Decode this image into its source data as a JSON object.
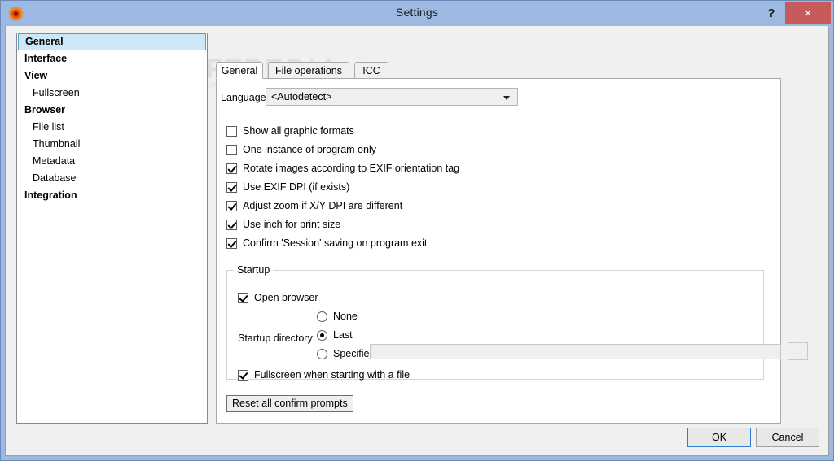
{
  "window": {
    "title": "Settings",
    "app_icon": "app-logo-icon",
    "help_label": "?",
    "close_label": "×",
    "accent_titlebar": "#9db9e2",
    "close_color": "#c75b5b",
    "selection_color": "#cce8f7"
  },
  "watermark": {
    "main": "SOFTPEDIA",
    "tm": "™",
    "sub": "www.softpedia.com"
  },
  "sidebar": {
    "items": [
      {
        "label": "General",
        "level": "top",
        "selected": true
      },
      {
        "label": "Interface",
        "level": "top",
        "selected": false
      },
      {
        "label": "View",
        "level": "top",
        "selected": false
      },
      {
        "label": "Fullscreen",
        "level": "sub",
        "selected": false
      },
      {
        "label": "Browser",
        "level": "top",
        "selected": false
      },
      {
        "label": "File list",
        "level": "sub",
        "selected": false
      },
      {
        "label": "Thumbnail",
        "level": "sub",
        "selected": false
      },
      {
        "label": "Metadata",
        "level": "sub",
        "selected": false
      },
      {
        "label": "Database",
        "level": "sub",
        "selected": false
      },
      {
        "label": "Integration",
        "level": "top",
        "selected": false
      }
    ]
  },
  "tabs": [
    {
      "label": "General",
      "active": true
    },
    {
      "label": "File operations",
      "active": false
    },
    {
      "label": "ICC",
      "active": false
    }
  ],
  "general_tab": {
    "language_label": "Language",
    "language_value": "<Autodetect>",
    "language_arrow_icon": "chevron-down-icon",
    "checkboxes": [
      {
        "label": "Show all graphic formats",
        "checked": false
      },
      {
        "label": "One instance of program only",
        "checked": false
      },
      {
        "label": "Rotate images according to EXIF orientation tag",
        "checked": true
      },
      {
        "label": "Use EXIF DPI (if exists)",
        "checked": true
      },
      {
        "label": "Adjust zoom if X/Y DPI are different",
        "checked": true
      },
      {
        "label": "Use inch for print size",
        "checked": true
      },
      {
        "label": "Confirm 'Session' saving on program exit",
        "checked": true
      }
    ],
    "startup": {
      "legend": "Startup",
      "open_browser_label": "Open browser",
      "open_browser_checked": true,
      "directory_label": "Startup directory:",
      "radios": [
        {
          "label": "None",
          "selected": false
        },
        {
          "label": "Last",
          "selected": true
        },
        {
          "label": "Specified",
          "selected": false
        }
      ],
      "specified_path": "",
      "browse_label": "...",
      "fullscreen_label": "Fullscreen when starting with a file",
      "fullscreen_checked": true
    },
    "reset_label": "Reset all confirm prompts"
  },
  "footer": {
    "ok_label": "OK",
    "cancel_label": "Cancel"
  }
}
